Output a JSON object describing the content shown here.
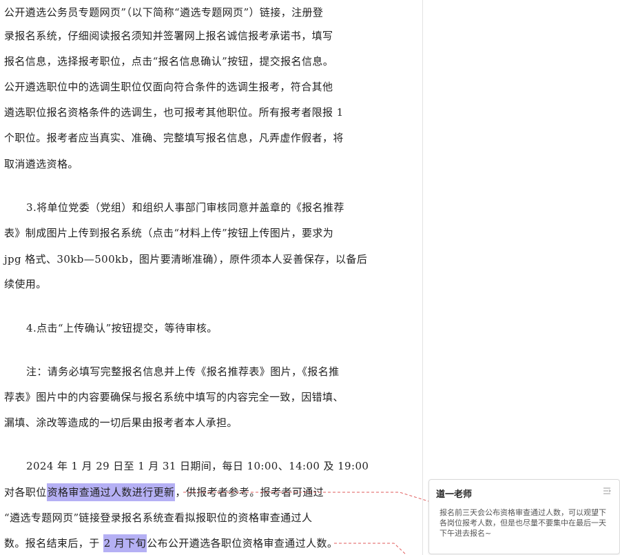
{
  "document": {
    "lines": [
      "公开遴选公务员专题网页”（以下简称“遴选专题网页”）链接，注册登",
      "录报名系统，仔细阅读报名须知并签署网上报名诚信报考承诺书，填写",
      "报名信息，选择报考职位，点击“报名信息确认”按钮，提交报名信息。",
      "公开遴选职位中的选调生职位仅面向符合条件的选调生报考，符合其他",
      "遴选职位报名资格条件的选调生，也可报考其他职位。所有报考者限报 1",
      "个职位。报考者应当真实、准确、完整填写报名信息，凡弄虚作假者，将",
      "取消遴选资格。",
      "3.将单位党委（党组）和组织人事部门审核同意并盖章的《报名推荐",
      "表》制成图片上传到报名系统（点击“材料上传”按钮上传图片，要求为",
      "jpg 格式、30kb—500kb，图片要清晰准确），原件须本人妥善保存，以备后",
      "续使用。",
      "4.点击“上传确认”按钮提交，等待审核。",
      "注：请务必填写完整报名信息并上传《报名推荐表》图片，《报名推",
      "荐表》图片中的内容要确保与报名系统中填写的内容完全一致，因错填、",
      "漏填、涂改等造成的一切后果由报考者本人承担。",
      "2024 年 1 月 29 日至 1 月 31 日期间，每日 10:00、14:00 及 19:00"
    ],
    "hl_line1": {
      "before": "对各职位",
      "highlight": "资格审查通过人数进行更新",
      "after": "，供报考者参考。报考者可通过"
    },
    "line_after_hl1": "“遴选专题网页”链接登录报名系统查看拟报职位的资格审查通过人",
    "hl_line2": {
      "before": "数。报名结束后，于 ",
      "highlight": "2 月下旬",
      "after": "公布公开遴选各职位资格审查通过人数。"
    }
  },
  "comment": {
    "author": "道一老师",
    "text": "报名前三天会公布资格审查通过人数，可以观望下各岗位报考人数，但是也尽量不要集中在最后一天下午进去报名~",
    "menu_icon": "comment-menu-icon"
  },
  "colors": {
    "highlight": "#b5b0f4",
    "connector": "#e05a5a"
  }
}
